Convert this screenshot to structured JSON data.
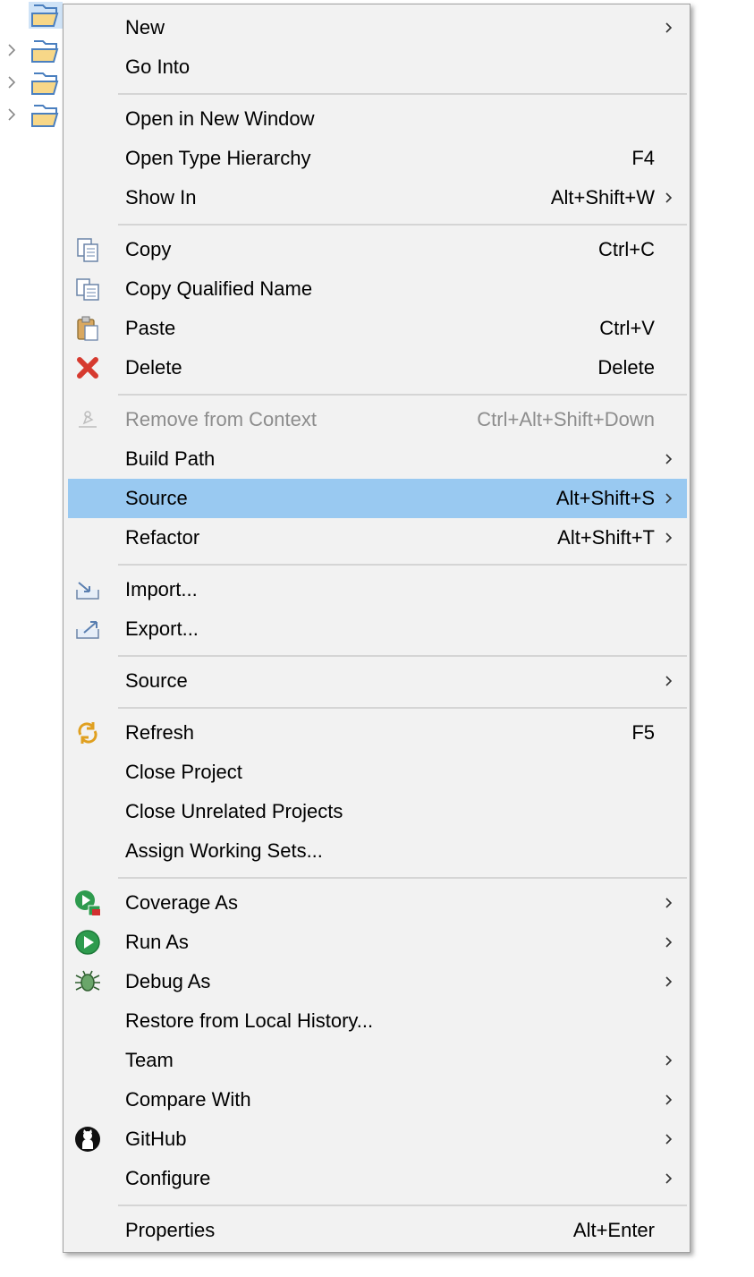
{
  "menu": {
    "items": [
      {
        "name": "new",
        "label": "New",
        "submenu": true
      },
      {
        "name": "go-into",
        "label": "Go Into"
      },
      {
        "name": "open-in-new-window",
        "label": "Open in New Window"
      },
      {
        "name": "open-type-hierarchy",
        "label": "Open Type Hierarchy",
        "shortcut": "F4"
      },
      {
        "name": "show-in",
        "label": "Show In",
        "shortcut": "Alt+Shift+W",
        "submenu": true
      },
      {
        "name": "copy",
        "label": "Copy",
        "shortcut": "Ctrl+C",
        "icon": "copy-icon"
      },
      {
        "name": "copy-qualified-name",
        "label": "Copy Qualified Name",
        "icon": "copy-qualified-name-icon"
      },
      {
        "name": "paste",
        "label": "Paste",
        "shortcut": "Ctrl+V",
        "icon": "paste-icon"
      },
      {
        "name": "delete",
        "label": "Delete",
        "shortcut": "Delete",
        "icon": "delete-icon"
      },
      {
        "name": "remove-from-context",
        "label": "Remove from Context",
        "shortcut": "Ctrl+Alt+Shift+Down",
        "icon": "remove-from-context-icon",
        "disabled": true
      },
      {
        "name": "build-path",
        "label": "Build Path",
        "submenu": true
      },
      {
        "name": "source",
        "label": "Source",
        "shortcut": "Alt+Shift+S",
        "submenu": true,
        "highlighted": true
      },
      {
        "name": "refactor",
        "label": "Refactor",
        "shortcut": "Alt+Shift+T",
        "submenu": true
      },
      {
        "name": "import",
        "label": "Import...",
        "icon": "import-icon"
      },
      {
        "name": "export",
        "label": "Export...",
        "icon": "export-icon"
      },
      {
        "name": "source-2",
        "label": "Source",
        "submenu": true
      },
      {
        "name": "refresh",
        "label": "Refresh",
        "shortcut": "F5",
        "icon": "refresh-icon"
      },
      {
        "name": "close-project",
        "label": "Close Project"
      },
      {
        "name": "close-unrelated-projects",
        "label": "Close Unrelated Projects"
      },
      {
        "name": "assign-working-sets",
        "label": "Assign Working Sets..."
      },
      {
        "name": "coverage-as",
        "label": "Coverage As",
        "submenu": true,
        "icon": "coverage-icon"
      },
      {
        "name": "run-as",
        "label": "Run As",
        "submenu": true,
        "icon": "run-icon"
      },
      {
        "name": "debug-as",
        "label": "Debug As",
        "submenu": true,
        "icon": "debug-bug-icon"
      },
      {
        "name": "restore-from-local-history",
        "label": "Restore from Local History..."
      },
      {
        "name": "team",
        "label": "Team",
        "submenu": true
      },
      {
        "name": "compare-with",
        "label": "Compare With",
        "submenu": true
      },
      {
        "name": "github",
        "label": "GitHub",
        "submenu": true,
        "icon": "github-icon"
      },
      {
        "name": "configure",
        "label": "Configure",
        "submenu": true
      },
      {
        "name": "properties",
        "label": "Properties",
        "shortcut": "Alt+Enter"
      }
    ]
  },
  "colors": {
    "menu_background": "#f2f2f2",
    "highlight": "#99c9f1",
    "disabled_text": "#8d8d8d",
    "separator": "#d5d5d5"
  }
}
